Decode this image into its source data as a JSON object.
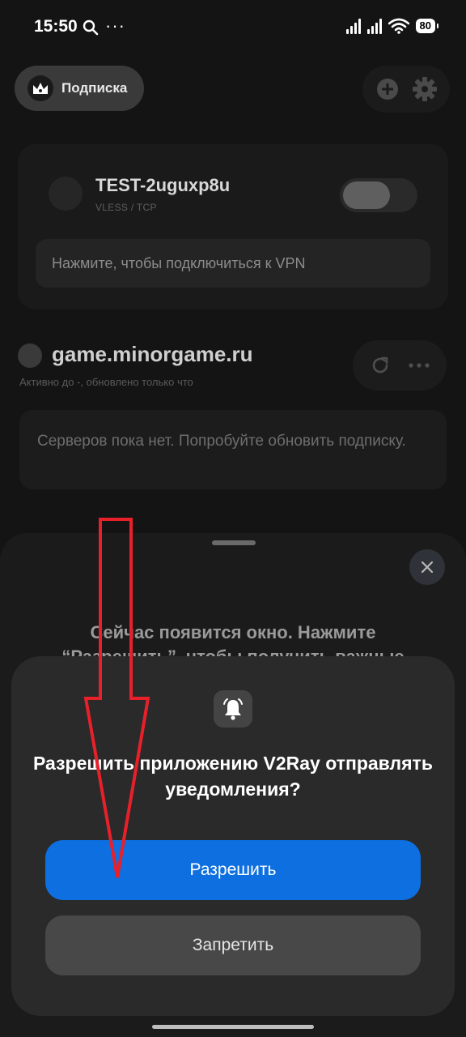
{
  "status_bar": {
    "time": "15:50",
    "battery": "80"
  },
  "top_bar": {
    "subscription_label": "Подписка"
  },
  "server": {
    "name": "TEST-2uguxp8u",
    "protocol": "VLESS / TCP",
    "connect_hint": "Нажмите, чтобы подключиться к VPN",
    "enabled": false
  },
  "subscription": {
    "title": "game.minorgame.ru",
    "meta": "Активно до -, обновлено только что",
    "empty_message": "Серверов пока нет. Попробуйте обновить подписку."
  },
  "sheet": {
    "text": "Сейчас появится окно. Нажмите “Разрешить”, чтобы получить важные"
  },
  "dialog": {
    "title": "Разрешить приложению V2Ray отправлять уведомления?",
    "allow_label": "Разрешить",
    "deny_label": "Запретить"
  },
  "colors": {
    "accent": "#0d6fe0",
    "annotation_arrow": "#e8202a"
  },
  "icons": [
    "search-icon",
    "more-icon",
    "signal-icon",
    "wifi-icon",
    "battery-icon",
    "crown-icon",
    "add-icon",
    "settings-icon",
    "refresh-icon",
    "more-horizontal-icon",
    "close-icon",
    "bell-icon"
  ]
}
